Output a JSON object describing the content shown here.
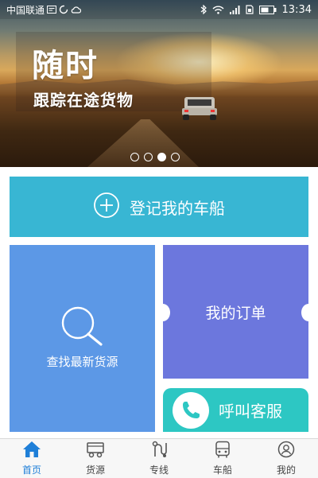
{
  "status_bar": {
    "carrier": "中国联通",
    "time": "13:34",
    "icons": [
      "message-icon",
      "sync-icon",
      "cloud-icon",
      "bluetooth-icon",
      "wifi-icon",
      "signal-icon",
      "sim-icon",
      "battery-icon"
    ]
  },
  "banner": {
    "title": "随时",
    "subtitle": "跟踪在途货物",
    "slide_count": 4,
    "active_slide": 3
  },
  "actions": {
    "register": "登记我的车船",
    "find_cargo": "查找最新货源",
    "my_orders": "我的订单",
    "customer_service": "呼叫客服"
  },
  "colors": {
    "register": "#38b6d3",
    "find_cargo": "#5c98e6",
    "my_orders": "#6c77dd",
    "customer_service": "#2dc7c3",
    "nav_active": "#1f7fd8"
  },
  "bottom_nav": {
    "items": [
      {
        "label": "首页",
        "icon": "home-icon",
        "active": true
      },
      {
        "label": "货源",
        "icon": "cargo-icon",
        "active": false
      },
      {
        "label": "专线",
        "icon": "route-icon",
        "active": false
      },
      {
        "label": "车船",
        "icon": "vehicle-icon",
        "active": false
      },
      {
        "label": "我的",
        "icon": "profile-icon",
        "active": false
      }
    ]
  }
}
